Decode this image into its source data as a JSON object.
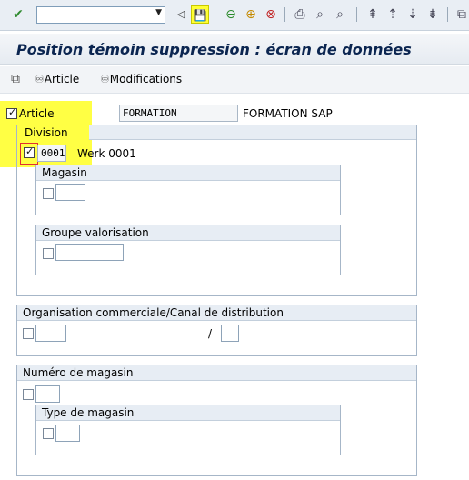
{
  "toolbar": {
    "command_value": "",
    "icons": [
      "check-icon",
      "back-triangle-icon",
      "save-icon",
      "back-icon",
      "exit-icon",
      "cancel-icon",
      "print-icon",
      "find-icon",
      "find-next-icon",
      "first-page-icon",
      "previous-page-icon",
      "next-page-icon",
      "last-page-icon",
      "create-session-icon"
    ],
    "highlight_color": "#ffff33"
  },
  "header": {
    "title": "Position témoin suppression : écran de données"
  },
  "app_toolbar": {
    "items": [
      {
        "label": "Article",
        "icon": "glasses-icon"
      },
      {
        "label": "Modifications",
        "icon": "glasses-icon"
      }
    ]
  },
  "article": {
    "label": "Article",
    "checked": true,
    "value": "FORMATION",
    "description": "FORMATION SAP"
  },
  "division": {
    "title": "Division",
    "checked": true,
    "value": "0001",
    "description": "Werk 0001"
  },
  "magasin": {
    "title": "Magasin",
    "value": ""
  },
  "groupe_valorisation": {
    "title": "Groupe valorisation",
    "value": ""
  },
  "org_commerciale": {
    "title": "Organisation commerciale/Canal de distribution",
    "value_org": "",
    "separator": "/",
    "value_canal": ""
  },
  "numero_magasin": {
    "title": "Numéro de magasin",
    "value": ""
  },
  "type_magasin": {
    "title": "Type de magasin",
    "value": ""
  }
}
